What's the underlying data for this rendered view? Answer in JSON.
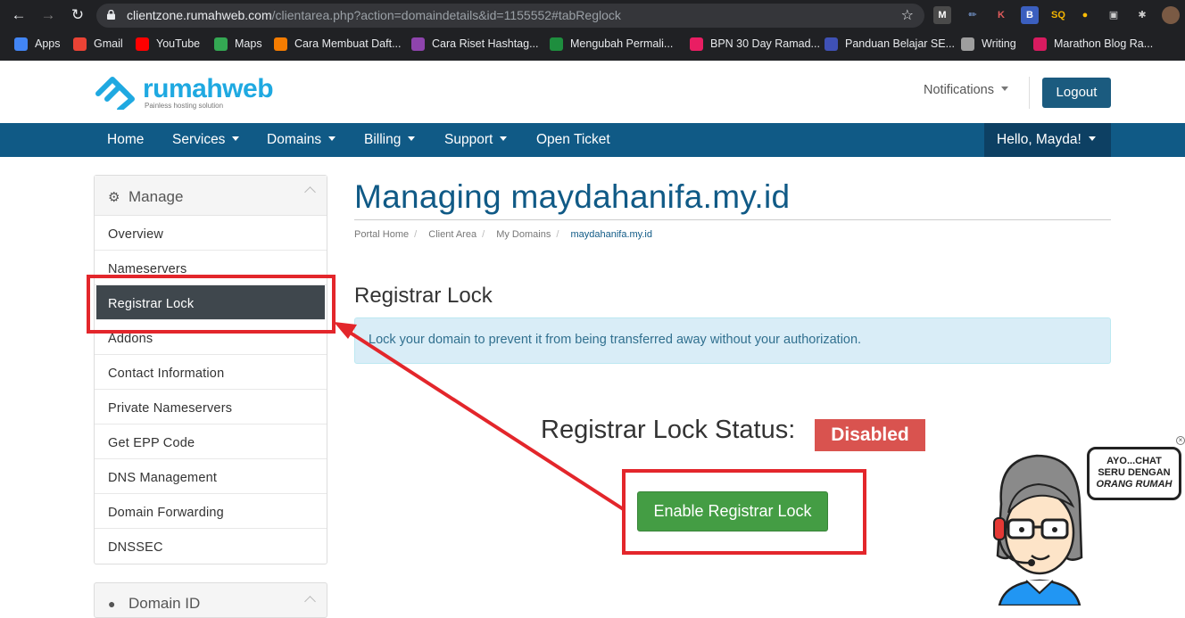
{
  "browser": {
    "url_domain": "clientzone.rumahweb.com",
    "url_path": "/clientarea.php?action=domaindetails&id=1155552#tabReglock",
    "bookmarks": [
      {
        "label": "Apps",
        "color": "#4285f4"
      },
      {
        "label": "Gmail",
        "color": "#ea4335"
      },
      {
        "label": "YouTube",
        "color": "#ff0000"
      },
      {
        "label": "Maps",
        "color": "#34a853"
      },
      {
        "label": "Cara Membuat Daft...",
        "color": "#f57c00"
      },
      {
        "label": "Cara Riset Hashtag...",
        "color": "#8e44ad"
      },
      {
        "label": "Mengubah Permali...",
        "color": "#1e8e3e"
      },
      {
        "label": "BPN 30 Day Ramad...",
        "color": "#e91e63"
      },
      {
        "label": "Panduan Belajar SE...",
        "color": "#3f51b5"
      },
      {
        "label": "Writing",
        "color": "#9e9e9e"
      },
      {
        "label": "Marathon Blog Ra...",
        "color": "#d81b60"
      }
    ]
  },
  "header": {
    "logo_text": "rumahweb",
    "logo_tagline": "Painless hosting solution",
    "notifications": "Notifications",
    "logout": "Logout"
  },
  "nav": {
    "items": [
      "Home",
      "Services",
      "Domains",
      "Billing",
      "Support",
      "Open Ticket"
    ],
    "user": "Hello, Mayda!"
  },
  "sidebar": {
    "title": "Manage",
    "items": [
      "Overview",
      "Nameservers",
      "Registrar Lock",
      "Addons",
      "Contact Information",
      "Private Nameservers",
      "Get EPP Code",
      "DNS Management",
      "Domain Forwarding",
      "DNSSEC"
    ],
    "active": "Registrar Lock",
    "second_title": "Domain ID"
  },
  "main": {
    "title": "Managing maydahanifa.my.id",
    "breadcrumb": [
      "Portal Home",
      "Client Area",
      "My Domains",
      "maydahanifa.my.id"
    ],
    "section_title": "Registrar Lock",
    "info": "Lock your domain to prevent it from being transferred away without your authorization.",
    "status_label": "Registrar Lock Status:",
    "status_value": "Disabled",
    "button": "Enable Registrar Lock"
  },
  "chat_widget": {
    "line1": "AYO...CHAT",
    "line2": "SERU DENGAN",
    "line3": "ORANG RUMAH"
  },
  "colors": {
    "brand": "#105a86",
    "annotation": "#e3262b",
    "success": "#449d44",
    "danger": "#d9534f"
  }
}
